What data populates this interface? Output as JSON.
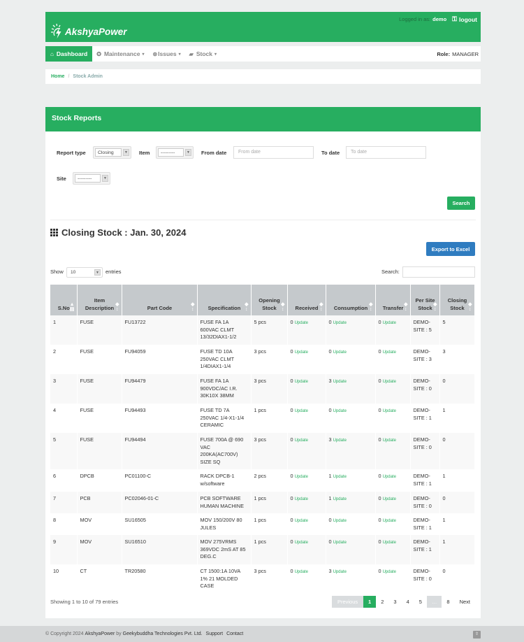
{
  "header": {
    "brand": "AkshyaPower",
    "logged_in_label": "Logged in as:",
    "username": "demo",
    "logout_label": "logout"
  },
  "nav": {
    "items": [
      {
        "label": "Dashboard",
        "icon": "home-icon"
      },
      {
        "label": "Maintenance",
        "icon": "wrench-icon"
      },
      {
        "label": "Issues",
        "icon": "issue-icon"
      },
      {
        "label": "Stock",
        "icon": "folder-icon"
      }
    ],
    "role_label": "Role:",
    "role_value": "MANAGER"
  },
  "breadcrumb": {
    "home": "Home",
    "current": "Stock Admin"
  },
  "panel": {
    "title": "Stock Reports"
  },
  "filters": {
    "report_type_label": "Report type",
    "report_type_value": "Closing",
    "item_label": "Item",
    "item_value": "---------",
    "from_label": "From date",
    "from_placeholder": "From date",
    "to_label": "To date",
    "to_placeholder": "To date",
    "site_label": "Site",
    "site_value": "---------",
    "search_button": "Search"
  },
  "report": {
    "title": "Closing Stock : Jan. 30, 2024",
    "export_button": "Export to Excel",
    "show_label": "Show",
    "show_value": "10",
    "entries_label": "entries",
    "search_label": "Search:",
    "info": "Showing 1 to 10 of 79 entries"
  },
  "table": {
    "headers": [
      "S.No",
      "Item Description",
      "Part Code",
      "Specification",
      "Opening Stock",
      "Received",
      "Consumption",
      "Transfer",
      "Per Site Stock",
      "Closing Stock"
    ],
    "update_label": "Update",
    "rows": [
      {
        "sno": "1",
        "item": "FUSE",
        "part": "FU13722",
        "spec": "FUSE FA 1A 600VAC CLMT 13/32DIAX1-1/2",
        "opening": "5 pcs",
        "received": "0",
        "consumption": "0",
        "transfer": "0",
        "site": "DEMO-SITE : 5",
        "closing": "5"
      },
      {
        "sno": "2",
        "item": "FUSE",
        "part": "FU94059",
        "spec": "FUSE TD 10A 250VAC CLMT 1/4DIAX1-1/4",
        "opening": "3 pcs",
        "received": "0",
        "consumption": "0",
        "transfer": "0",
        "site": "DEMO-SITE : 3",
        "closing": "3"
      },
      {
        "sno": "3",
        "item": "FUSE",
        "part": "FU94479",
        "spec": "FUSE FA 1A 900VDC/AC I.R. 30K10X 38MM",
        "opening": "3 pcs",
        "received": "0",
        "consumption": "3",
        "transfer": "0",
        "site": "DEMO-SITE : 0",
        "closing": "0"
      },
      {
        "sno": "4",
        "item": "FUSE",
        "part": "FU94493",
        "spec": "FUSE TD 7A 250VAC 1/4-X1-1/4 CERAMIC",
        "opening": "1 pcs",
        "received": "0",
        "consumption": "0",
        "transfer": "0",
        "site": "DEMO-SITE : 1",
        "closing": "1"
      },
      {
        "sno": "5",
        "item": "FUSE",
        "part": "FU94494",
        "spec": "FUSE 700A @ 690 VAC 200KA(AC700V) SIZE SQ",
        "opening": "3 pcs",
        "received": "0",
        "consumption": "3",
        "transfer": "0",
        "site": "DEMO-SITE : 0",
        "closing": "0"
      },
      {
        "sno": "6",
        "item": "DPCB",
        "part": "PC01100-C",
        "spec": "RACK DPCB-1 w/software",
        "opening": "2 pcs",
        "received": "0",
        "consumption": "1",
        "transfer": "0",
        "site": "DEMO-SITE : 1",
        "closing": "1"
      },
      {
        "sno": "7",
        "item": "PCB",
        "part": "PC02046-01-C",
        "spec": "PCB SOFTWARE HUMAN MACHINE",
        "opening": "1 pcs",
        "received": "0",
        "consumption": "1",
        "transfer": "0",
        "site": "DEMO-SITE : 0",
        "closing": "0"
      },
      {
        "sno": "8",
        "item": "MOV",
        "part": "SU16505",
        "spec": "MOV 150/200V 80 JULES",
        "opening": "1 pcs",
        "received": "0",
        "consumption": "0",
        "transfer": "0",
        "site": "DEMO-SITE : 1",
        "closing": "1"
      },
      {
        "sno": "9",
        "item": "MOV",
        "part": "SU16510",
        "spec": "MOV 275VRMS 369VDC 2mS AT 85 DEG.C",
        "opening": "1 pcs",
        "received": "0",
        "consumption": "0",
        "transfer": "0",
        "site": "DEMO-SITE : 1",
        "closing": "1"
      },
      {
        "sno": "10",
        "item": "CT",
        "part": "TR20580",
        "spec": "CT 1500:1A 10VA 1% 21 MOLDED CASE",
        "opening": "3 pcs",
        "received": "0",
        "consumption": "3",
        "transfer": "0",
        "site": "DEMO-SITE : 0",
        "closing": "0"
      }
    ]
  },
  "pagination": {
    "prev": "Previous",
    "pages": [
      "1",
      "2",
      "3",
      "4",
      "5",
      "…",
      "8"
    ],
    "active": "1",
    "next": "Next"
  },
  "footer": {
    "copyright": "© Copyright 2024",
    "brand": "AkshyaPower",
    "by": "by",
    "company": "Geekybuddha Technologies Pvt. Ltd.",
    "support": "Support",
    "contact": "Contact"
  },
  "colors": {
    "accent": "#27ae60",
    "export": "#2f7cc0",
    "table_header": "#c5c9cc"
  }
}
